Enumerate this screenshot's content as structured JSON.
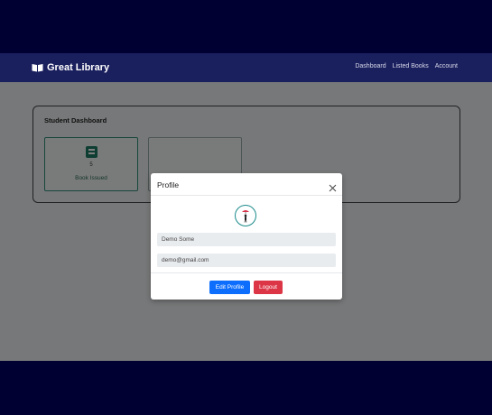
{
  "navbar": {
    "brand": "Great Library",
    "brand_icon": "book-icon",
    "links": [
      "Dashboard",
      "Listed Books",
      "Account"
    ]
  },
  "dashboard": {
    "title": "Student Dashboard",
    "cards": [
      {
        "count": "5",
        "label": "Book Issued",
        "icon": "book-icon"
      }
    ]
  },
  "modal": {
    "title": "Profile",
    "close_icon": "close-icon",
    "name_value": "Demo Some",
    "email_value": "demo@gmail.com",
    "edit_label": "Edit Profile",
    "logout_label": "Logout"
  },
  "colors": {
    "page_background": "#000033",
    "navbar": "#1a1f5e",
    "accent_green": "#1c7a63",
    "primary": "#0d6efd",
    "danger": "#dc3545"
  }
}
